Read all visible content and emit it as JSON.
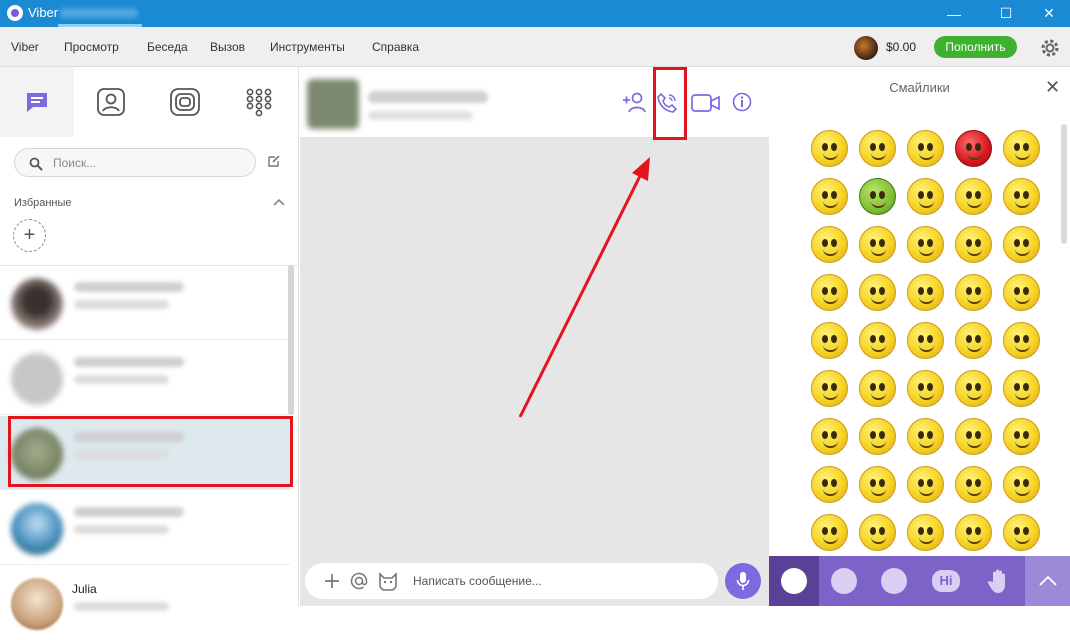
{
  "window": {
    "app_name": "Viber",
    "minimize_glyph": "—",
    "maximize_glyph": "☐",
    "close_glyph": "✕"
  },
  "menu": {
    "items": [
      "Viber",
      "Просмотр",
      "Беседа",
      "Вызов",
      "Инструменты",
      "Справка"
    ],
    "balance": "$0.00",
    "topup_label": "Пополнить"
  },
  "sidebar": {
    "tabs": [
      {
        "icon": "chats-icon"
      },
      {
        "icon": "contacts-icon"
      },
      {
        "icon": "public-chats-icon"
      },
      {
        "icon": "dialpad-icon"
      }
    ],
    "search_placeholder": "Поиск...",
    "favorites_title": "Избранные",
    "add_glyph": "+",
    "chats": [
      {
        "avatar_color": "#5b4a44",
        "selected": false
      },
      {
        "avatar_color": "#c7c7c7",
        "selected": false
      },
      {
        "avatar_color": "#7d8b6a",
        "selected": true
      },
      {
        "avatar_color": "#3f88b8",
        "selected": false
      },
      {
        "name": "Julia",
        "avatar_color": "#caa27a",
        "selected": false
      }
    ]
  },
  "conversation": {
    "composer_placeholder": "Написать сообщение...",
    "header_icons": [
      "add-participant-icon",
      "voice-call-icon",
      "video-call-icon",
      "info-icon"
    ]
  },
  "emoji_panel": {
    "title": "Смайлики",
    "close_glyph": "✕",
    "tabs": [
      {
        "icon": "smiley-tab-icon"
      },
      {
        "icon": "sticker-pack-1-icon"
      },
      {
        "icon": "sticker-pack-2-icon"
      },
      {
        "icon": "hi-sticker-icon",
        "label": "Hi"
      },
      {
        "icon": "hand-sticker-icon"
      },
      {
        "icon": "collapse-up-icon"
      }
    ]
  },
  "colors": {
    "titlebar": "#1a8ad4",
    "accent": "#7b6ae0",
    "highlight_box": "#e2151d",
    "topup": "#3fb131"
  }
}
